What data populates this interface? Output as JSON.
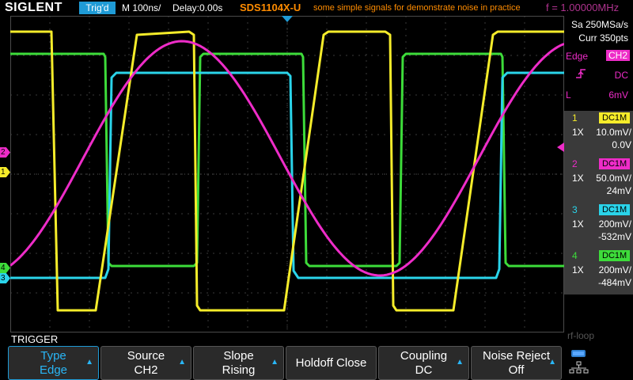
{
  "brand": "SIGLENT",
  "status_badge": "Trig'd",
  "timebase": "M 100ns/",
  "delay": "Delay:0.00s",
  "model": "SDS1104X-U",
  "description": "some simple signals for demonstrate noise in practice",
  "frequency": "f = 1.00000MHz",
  "acquisition": {
    "sample_rate": "Sa 250MSa/s",
    "memory": "Curr 350pts"
  },
  "trigger_info": {
    "type": "Edge",
    "source": "CH2",
    "coupling": "DC",
    "level_label": "L",
    "level": "6mV",
    "slope_icon": "rising-edge-icon"
  },
  "channels": [
    {
      "num": "1",
      "coupling": "DC1M",
      "probe": "1X",
      "scale": "10.0mV/",
      "offset": "0.0V",
      "color": "#f5ec2a"
    },
    {
      "num": "2",
      "coupling": "DC1M",
      "probe": "1X",
      "scale": "50.0mV/",
      "offset": "24mV",
      "color": "#ee2cc8"
    },
    {
      "num": "3",
      "coupling": "DC1M",
      "probe": "1X",
      "scale": "200mV/",
      "offset": "-532mV",
      "color": "#2ad4ea"
    },
    {
      "num": "4",
      "coupling": "DC1M",
      "probe": "1X",
      "scale": "200mV/",
      "offset": "-484mV",
      "color": "#3ddc3a"
    }
  ],
  "menu": {
    "title": "TRIGGER",
    "buttons": [
      {
        "line1": "Type",
        "line2": "Edge",
        "arrow": true
      },
      {
        "line1": "Source",
        "line2": "CH2",
        "arrow": true
      },
      {
        "line1": "Slope",
        "line2": "Rising",
        "arrow": true
      },
      {
        "line1": "Holdoff Close",
        "line2": "",
        "arrow": false
      },
      {
        "line1": "Coupling",
        "line2": "DC",
        "arrow": true
      },
      {
        "line1": "Noise Reject",
        "line2": "Off",
        "arrow": true
      }
    ]
  },
  "watermark": "rf-loop",
  "marker_labels": {
    "ch1": "1",
    "ch2": "2",
    "ch3": "3",
    "ch4": "4"
  },
  "icons": {
    "trigger_position": "trigger-position-icon",
    "network": "network-icon"
  }
}
